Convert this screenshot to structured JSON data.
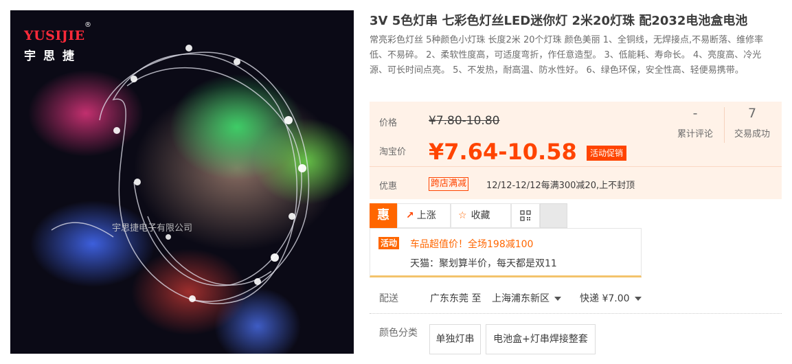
{
  "image": {
    "logo_text": "YUSIJIE",
    "logo_reg": "®",
    "logo_cn": "宇思捷",
    "company_text": "宇思捷电子有限公司"
  },
  "product": {
    "title": "3V 5色灯串 七彩色灯丝LED迷你灯 2米20灯珠 配2032电池盒电池",
    "description": "常亮彩色灯丝 5种颜色小灯珠 长度2米 20个灯珠 颜色美丽 1、全铜线，无焊接点,不易断落、维修率低、不易碎。 2、柔软性度高，可适度弯折，作任意造型。 3、低能耗、寿命长。 4、亮度高、冷光源、可长时间点亮。 5、不发热，耐高温、防水性好。 6、绿色环保，安全性高、轻便易携带。"
  },
  "price": {
    "original_label": "价格",
    "original_value": "¥7.80-10.80",
    "taobao_label": "淘宝价",
    "promo_currency": "¥",
    "promo_value": "7.64-10.58",
    "promo_badge": "活动促销"
  },
  "stats": {
    "reviews_value": "-",
    "reviews_label": "累计评论",
    "deals_value": "7",
    "deals_label": "交易成功"
  },
  "coupon": {
    "label": "优惠",
    "tag": "跨店满减",
    "text": "12/12-12/12每满300减20,上不封顶"
  },
  "tabs": {
    "hui": "惠",
    "rise_label": "上涨",
    "fav_label": "收藏"
  },
  "activity": {
    "badge": "活动",
    "line1": "车品超值价！全场198减100",
    "line2": "天猫：聚划算半价，每天都是双11"
  },
  "shipping": {
    "label": "配送",
    "from": "广东东莞 至",
    "to": "上海浦东新区",
    "method": "快递 ¥7.00"
  },
  "color_options": {
    "label": "颜色分类",
    "options": [
      "单独灯串",
      "电池盒+灯串焊接整套"
    ]
  },
  "colors": {
    "accent": "#ff4400",
    "price_panel_bg": "#fff2e8"
  }
}
